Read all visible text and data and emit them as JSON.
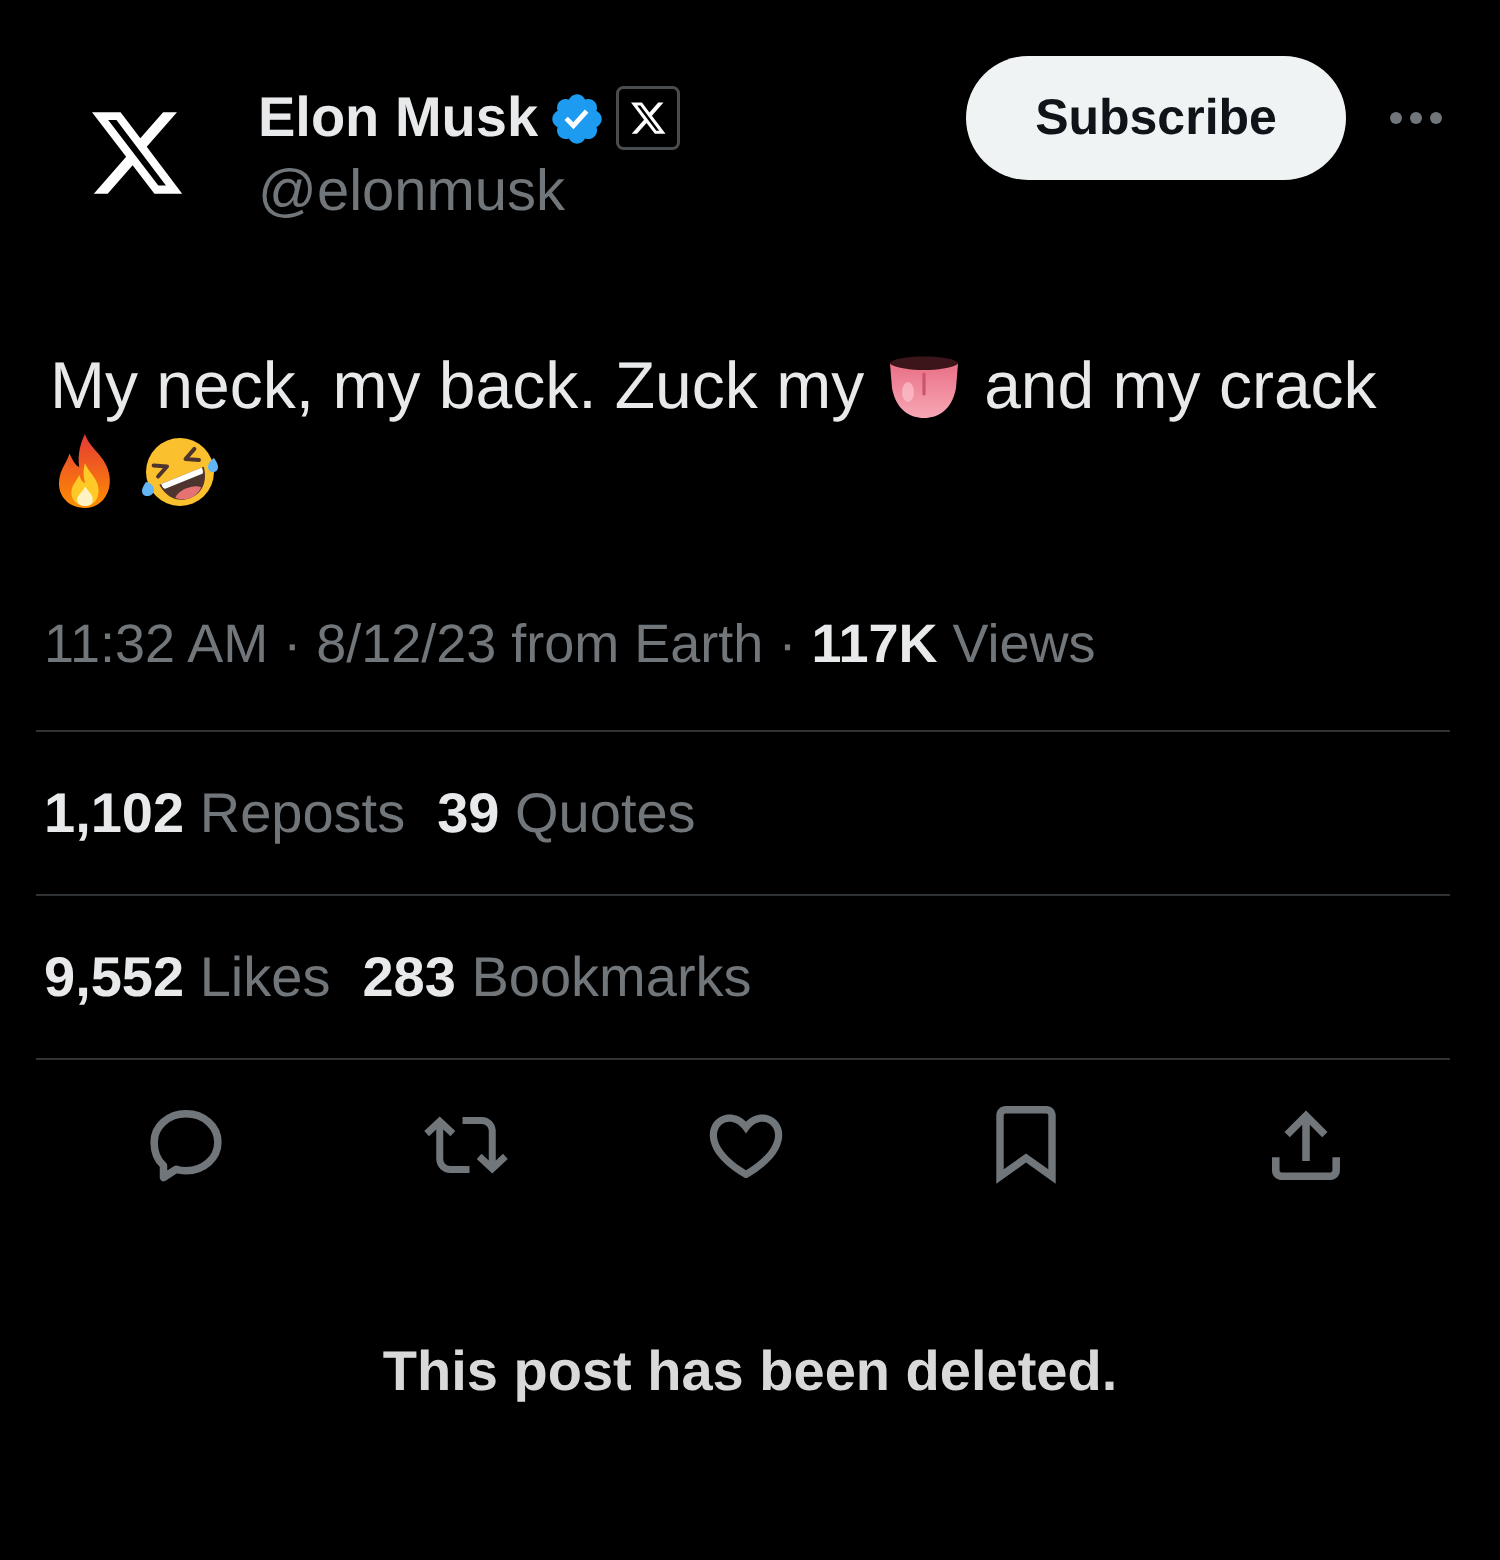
{
  "author": {
    "name": "Elon Musk",
    "verified": true,
    "affiliate_badge": true,
    "handle": "@elonmusk"
  },
  "subscribe_button": {
    "label": "Subscribe"
  },
  "post": {
    "content": [
      {
        "kind": "text",
        "text": "My neck, my back. Zuck my"
      },
      {
        "kind": "tongue"
      },
      {
        "kind": "text",
        "text": "and my crack"
      },
      {
        "kind": "fire"
      },
      {
        "kind": "laugh"
      }
    ]
  },
  "meta": "11:32 AM · 8/12/23 from Earth · **117K** Views",
  "stat_rows": [
    {
      "items": [
        {
          "count": "1,102",
          "label": "Reposts"
        },
        {
          "count": "39",
          "label": "Quotes"
        }
      ]
    },
    {
      "items": [
        {
          "count": "9,552",
          "label": "Likes"
        },
        {
          "count": "283",
          "label": "Bookmarks"
        }
      ]
    }
  ],
  "actions": [
    {
      "kind": "reply"
    },
    {
      "kind": "repost"
    },
    {
      "kind": "like"
    },
    {
      "kind": "bookmark"
    },
    {
      "kind": "share"
    }
  ],
  "notice": "This post has been deleted."
}
